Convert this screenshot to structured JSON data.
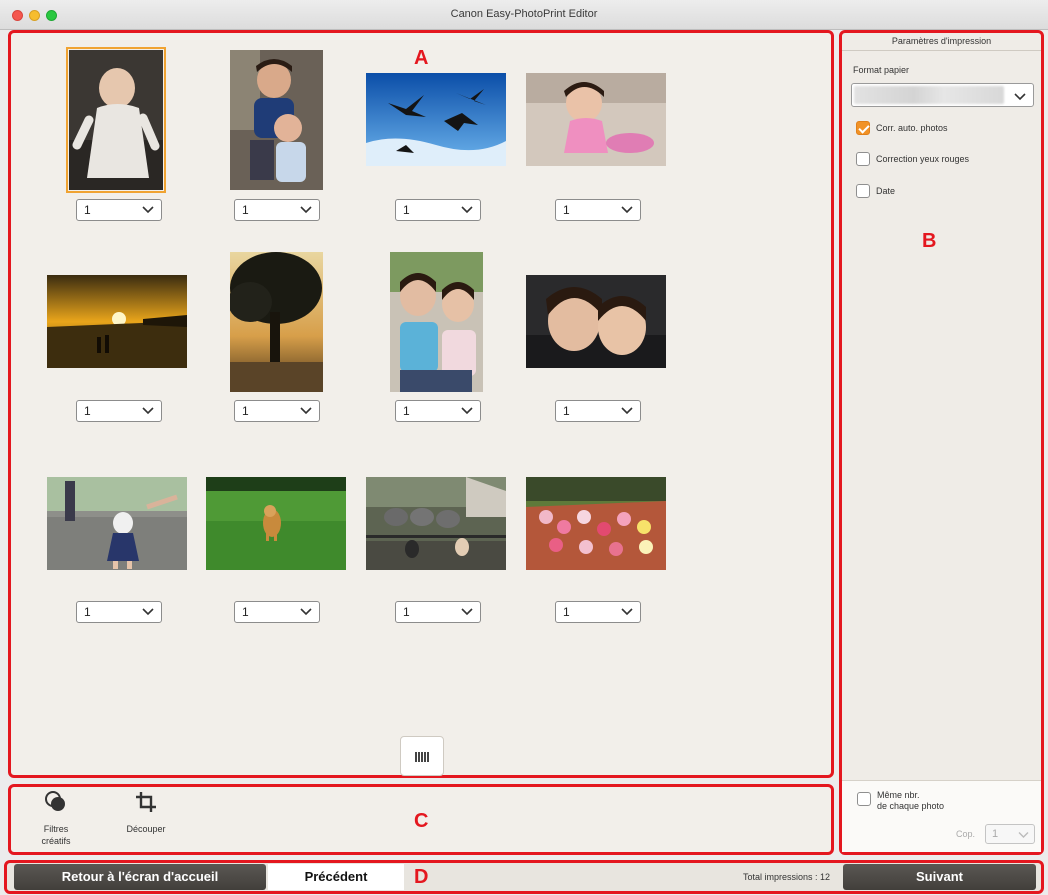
{
  "window": {
    "title": "Canon Easy-PhotoPrint Editor"
  },
  "labels": {
    "a": "A",
    "b": "B",
    "c": "C",
    "d": "D"
  },
  "photos": [
    {
      "qty": "1",
      "selected": true
    },
    {
      "qty": "1",
      "selected": false
    },
    {
      "qty": "1",
      "selected": false
    },
    {
      "qty": "1",
      "selected": false
    },
    {
      "qty": "1",
      "selected": false
    },
    {
      "qty": "1",
      "selected": false
    },
    {
      "qty": "1",
      "selected": false
    },
    {
      "qty": "1",
      "selected": false
    },
    {
      "qty": "1",
      "selected": false
    },
    {
      "qty": "1",
      "selected": false
    },
    {
      "qty": "1",
      "selected": false
    },
    {
      "qty": "1",
      "selected": false
    }
  ],
  "tools": {
    "filters_line1": "Filtres",
    "filters_line2": "créatifs",
    "crop": "Découper"
  },
  "panel": {
    "title": "Paramètres d'impression",
    "paper_label": "Format papier",
    "auto_correct": {
      "label": "Corr. auto. photos",
      "checked": true
    },
    "red_eye": {
      "label": "Correction yeux rouges",
      "checked": false
    },
    "date": {
      "label": "Date",
      "checked": false
    },
    "same_count_line1": "Même nbr.",
    "same_count_line2": "de chaque photo",
    "copies_label": "Cop.",
    "copies_value": "1"
  },
  "footer": {
    "home": "Retour à l'écran d'accueil",
    "back": "Précédent",
    "total": "Total impressions : 12",
    "next": "Suivant"
  },
  "colors": {
    "accent": "#f19226",
    "highlight": "#e4171f",
    "dark_button": "#4a4743"
  }
}
